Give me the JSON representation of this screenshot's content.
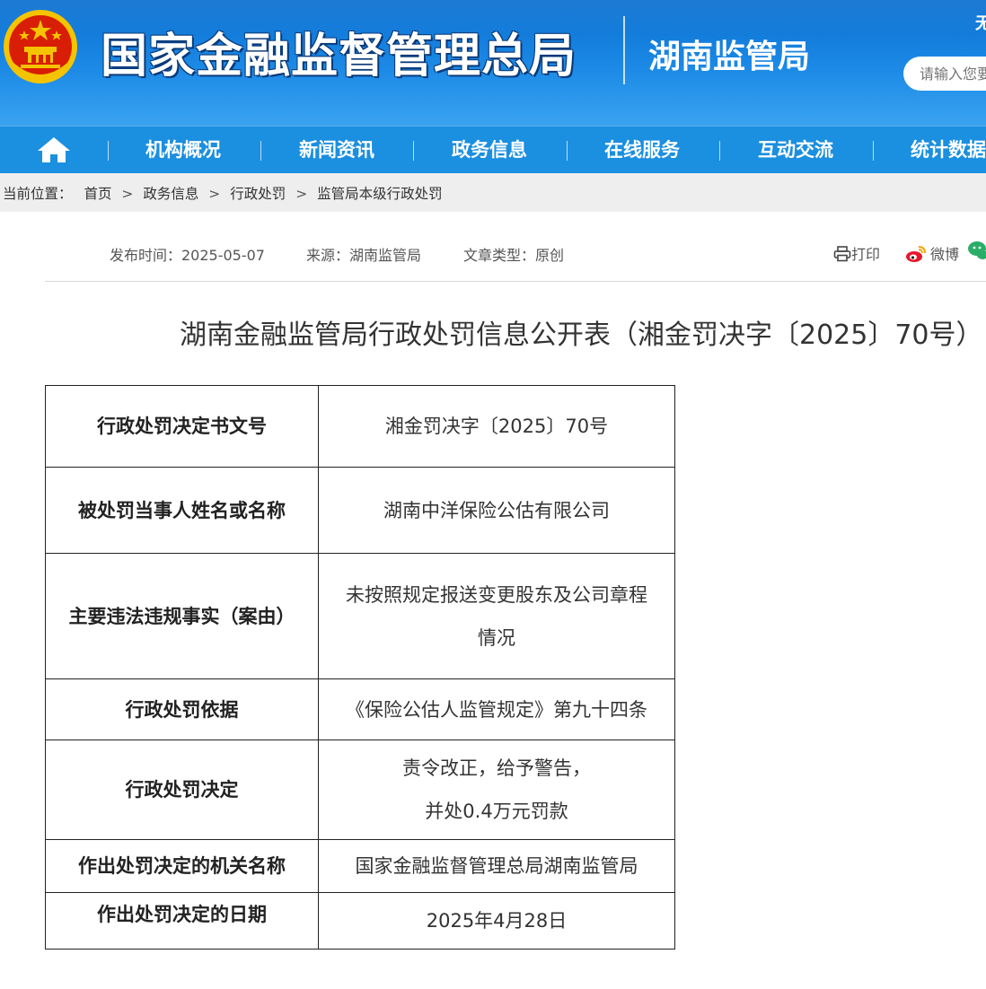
{
  "header": {
    "title": "国家金融监督管理总局",
    "subtitle": "湖南监管局",
    "top_link": "无",
    "search_placeholder": "请输入您要"
  },
  "nav": {
    "items": [
      "机构概况",
      "新闻资讯",
      "政务信息",
      "在线服务",
      "互动交流",
      "统计数据"
    ]
  },
  "breadcrumb": {
    "label": "当前位置：",
    "items": [
      "首页",
      "政务信息",
      "行政处罚",
      "监管局本级行政处罚"
    ],
    "separator": ">"
  },
  "meta": {
    "publish_time": "发布时间：2025-05-07",
    "source": "来源：湖南监管局",
    "article_type": "文章类型：原创"
  },
  "share": {
    "print": "打印",
    "weibo": "微博"
  },
  "article": {
    "title": "湖南金融监管局行政处罚信息公开表（湘金罚决字〔2025〕70号）"
  },
  "table": {
    "rows": [
      {
        "label": "行政处罚决定书文号",
        "value": [
          "湘金罚决字〔2025〕70号"
        ]
      },
      {
        "label": "被处罚当事人姓名或名称",
        "value": [
          "湖南中洋保险公估有限公司"
        ]
      },
      {
        "label": "主要违法违规事实（案由）",
        "value": [
          "未按照规定报送变更股东及公司章程",
          "情况"
        ]
      },
      {
        "label": "行政处罚依据",
        "value": [
          "《保险公估人监管规定》第九十四条"
        ]
      },
      {
        "label": "行政处罚决定",
        "value": [
          "责令改正，给予警告，",
          "并处0.4万元罚款"
        ]
      },
      {
        "label": "作出处罚决定的机关名称",
        "value": [
          "国家金融监督管理总局湖南监管局"
        ]
      },
      {
        "label": "作出处罚决定的日期",
        "value": [
          "2025年4月28日"
        ]
      }
    ]
  },
  "colors": {
    "header_blue": "#1c8ae6",
    "nav_blue": "#1b8fe0",
    "breadcrumb_bg": "#eeeeee",
    "emblem_red": "#d81e06",
    "emblem_gold": "#f5c400"
  },
  "icons": [
    "national-emblem-icon",
    "home-icon",
    "printer-icon",
    "weibo-icon",
    "wechat-icon"
  ]
}
